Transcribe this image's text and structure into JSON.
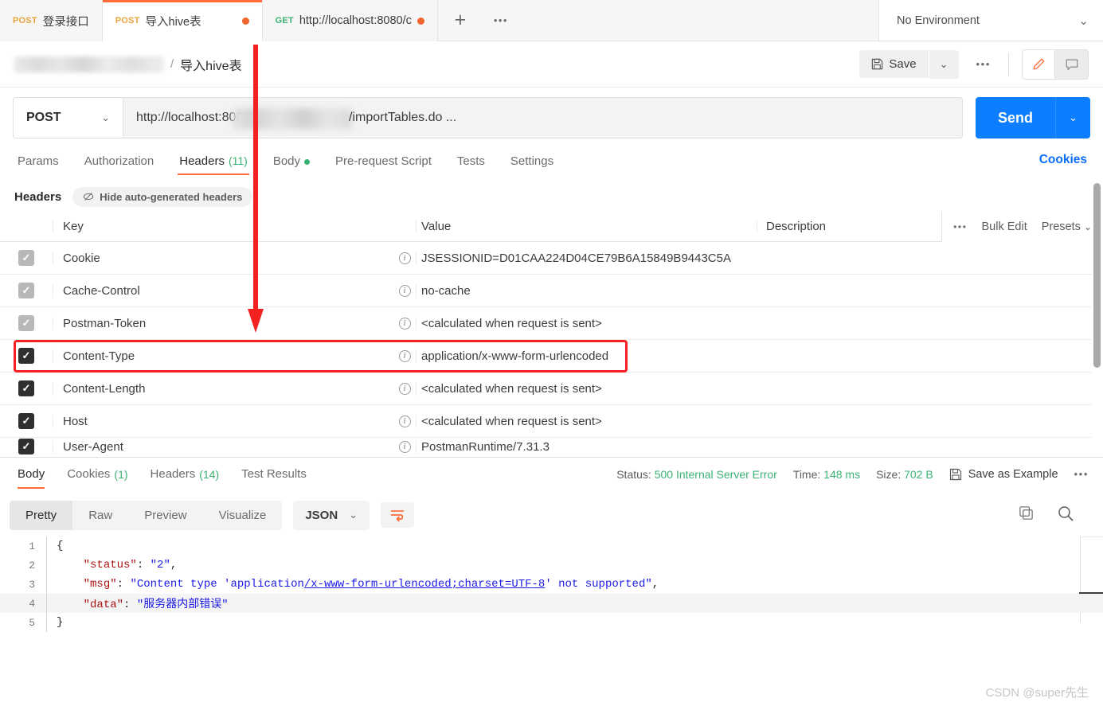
{
  "tabs": [
    {
      "method": "POST",
      "label": "登录接口",
      "unsaved": false,
      "active": false
    },
    {
      "method": "POST",
      "label": "导入hive表",
      "unsaved": true,
      "active": true
    },
    {
      "method": "GET",
      "label": "http://localhost:8080/c",
      "unsaved": true,
      "active": false
    }
  ],
  "tabbar": {
    "plus": "+",
    "more": "•••"
  },
  "environment": {
    "label": "No Environment",
    "caret": "⌄"
  },
  "breadcrumb": {
    "collection_redacted": "",
    "separator": "/",
    "name": "导入hive表"
  },
  "toolbar": {
    "save_label": "Save",
    "save_caret": "⌄",
    "more": "•••",
    "edit_icon": "pencil-icon",
    "comment_icon": "comment-icon"
  },
  "request": {
    "method": "POST",
    "method_caret": "⌄",
    "url_prefix": "http://localhost:8080/",
    "url_suffix": "/importTables.do ...",
    "send_label": "Send",
    "send_caret": "⌄"
  },
  "request_tabs": [
    {
      "label": "Params",
      "count": "",
      "active": false,
      "dot": false
    },
    {
      "label": "Authorization",
      "count": "",
      "active": false,
      "dot": false
    },
    {
      "label": "Headers",
      "count": "(11)",
      "active": true,
      "dot": false
    },
    {
      "label": "Body",
      "count": "",
      "active": false,
      "dot": true
    },
    {
      "label": "Pre-request Script",
      "count": "",
      "active": false,
      "dot": false
    },
    {
      "label": "Tests",
      "count": "",
      "active": false,
      "dot": false
    },
    {
      "label": "Settings",
      "count": "",
      "active": false,
      "dot": false
    }
  ],
  "cookies_link": "Cookies",
  "headers_subbar": {
    "label": "Headers",
    "hide_auto": "Hide auto-generated headers",
    "eye_icon": "eye-off-icon"
  },
  "headers_table": {
    "columns": [
      "Key",
      "Value",
      "Description"
    ],
    "actions": {
      "more": "•••",
      "bulk_edit": "Bulk Edit",
      "presets": "Presets",
      "presets_caret": "⌄"
    },
    "rows": [
      {
        "checked": true,
        "style": "gray",
        "key": "Cookie",
        "value": "JSESSIONID=D01CAA224D04CE79B6A15849B9443C5A",
        "description": "",
        "highlight": false
      },
      {
        "checked": true,
        "style": "gray",
        "key": "Cache-Control",
        "value": "no-cache",
        "description": "",
        "highlight": false
      },
      {
        "checked": true,
        "style": "gray",
        "key": "Postman-Token",
        "value": "<calculated when request is sent>",
        "description": "",
        "highlight": false
      },
      {
        "checked": true,
        "style": "dark",
        "key": "Content-Type",
        "value": "application/x-www-form-urlencoded",
        "description": "",
        "highlight": true
      },
      {
        "checked": true,
        "style": "dark",
        "key": "Content-Length",
        "value": "<calculated when request is sent>",
        "description": "",
        "highlight": false
      },
      {
        "checked": true,
        "style": "dark",
        "key": "Host",
        "value": "<calculated when request is sent>",
        "description": "",
        "highlight": false
      },
      {
        "checked": true,
        "style": "dark",
        "key": "User-Agent",
        "value": "PostmanRuntime/7.31.3",
        "description": "",
        "highlight": false
      }
    ]
  },
  "response_tabs": [
    {
      "label": "Body",
      "count": "",
      "active": true
    },
    {
      "label": "Cookies",
      "count": "(1)",
      "active": false
    },
    {
      "label": "Headers",
      "count": "(14)",
      "active": false
    },
    {
      "label": "Test Results",
      "count": "",
      "active": false
    }
  ],
  "response_meta": {
    "status_label": "Status:",
    "status_value": "500 Internal Server Error",
    "time_label": "Time:",
    "time_value": "148 ms",
    "size_label": "Size:",
    "size_value": "702 B",
    "save_example": "Save as Example",
    "more": "•••",
    "save_icon": "floppy-disk-icon"
  },
  "response_view": {
    "segments": [
      {
        "label": "Pretty",
        "active": true
      },
      {
        "label": "Raw",
        "active": false
      },
      {
        "label": "Preview",
        "active": false
      },
      {
        "label": "Visualize",
        "active": false
      }
    ],
    "format": "JSON",
    "format_caret": "⌄",
    "wrap_icon": "wrap-lines-icon",
    "copy_icon": "copy-icon",
    "search_icon": "search-icon"
  },
  "response_body": {
    "lines": [
      {
        "n": "1",
        "segments": [
          {
            "t": "{",
            "c": "p-dark"
          }
        ]
      },
      {
        "n": "2",
        "segments": [
          {
            "t": "    ",
            "c": "p-dark"
          },
          {
            "t": "\"status\"",
            "c": "k-red"
          },
          {
            "t": ": ",
            "c": "p-dark"
          },
          {
            "t": "\"2\"",
            "c": "v-blue"
          },
          {
            "t": ",",
            "c": "p-dark"
          }
        ]
      },
      {
        "n": "3",
        "segments": [
          {
            "t": "    ",
            "c": "p-dark"
          },
          {
            "t": "\"msg\"",
            "c": "k-red"
          },
          {
            "t": ": ",
            "c": "p-dark"
          },
          {
            "t": "\"Content type 'application",
            "c": "v-blue"
          },
          {
            "t": "/x-www-form-urlencoded;charset=UTF-8",
            "c": "v-link"
          },
          {
            "t": "' not supported\"",
            "c": "v-blue"
          },
          {
            "t": ",",
            "c": "p-dark"
          }
        ]
      },
      {
        "n": "4",
        "segments": [
          {
            "t": "    ",
            "c": "p-dark"
          },
          {
            "t": "\"data\"",
            "c": "k-red"
          },
          {
            "t": ": ",
            "c": "p-dark"
          },
          {
            "t": "\"服务器内部错误\"",
            "c": "v-blue"
          }
        ],
        "highlight": true
      },
      {
        "n": "5",
        "segments": [
          {
            "t": "}",
            "c": "p-dark"
          }
        ]
      }
    ]
  },
  "annotations": {
    "arrow_color": "#f42121",
    "box_color": "#f42121",
    "arrow_target": "Content-Type header row"
  },
  "watermark": "CSDN @super先生",
  "colors": {
    "accent": "#ff6c37",
    "send": "#0d7eff",
    "green": "#3bb273",
    "annotation_red": "#f42121"
  }
}
